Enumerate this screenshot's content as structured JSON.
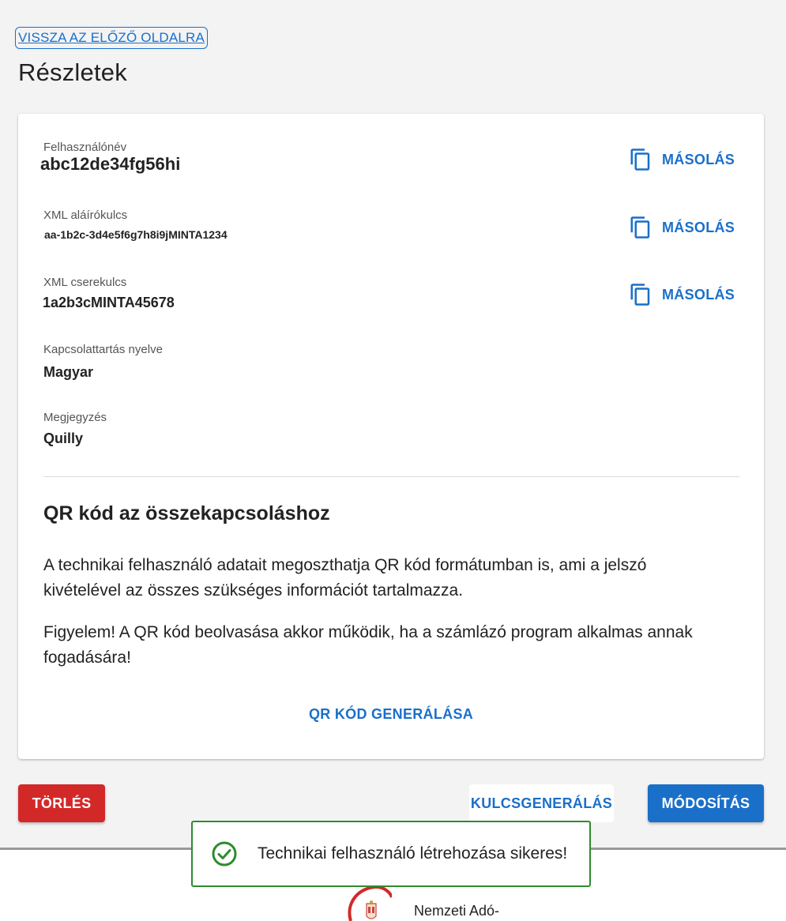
{
  "nav": {
    "back_label": "VISSZA AZ ELŐZŐ OLDALRA"
  },
  "page": {
    "title": "Részletek"
  },
  "details": {
    "username": {
      "label": "Felhasználónév",
      "value": "abc12de34fg56hi",
      "copy_label": "MÁSOLÁS"
    },
    "xml_signing_key": {
      "label": "XML aláírókulcs",
      "value": "aa-1b2c-3d4e5f6g7h8i9jMINTA1234",
      "copy_label": "MÁSOLÁS"
    },
    "xml_exchange_key": {
      "label": "XML cserekulcs",
      "value": "1a2b3cMINTA45678",
      "copy_label": "MÁSOLÁS"
    },
    "language": {
      "label": "Kapcsolattartás nyelve",
      "value": "Magyar"
    },
    "note": {
      "label": "Megjegyzés",
      "value": "Quilly"
    }
  },
  "qr": {
    "title": "QR kód az összekapcsoláshoz",
    "paragraph1": "A technikai felhasználó adatait megoszthatja QR kód formátumban is, ami a jelszó kivételével az összes szükséges információt tartalmazza.",
    "paragraph2": "Figyelem! A QR kód beolvasása akkor működik, ha a számlázó program alkalmas annak fogadására!",
    "generate_label": "QR KÓD GENERÁLÁSA"
  },
  "actions": {
    "delete_label": "TÖRLÉS",
    "keygen_label": "KULCSGENERÁLÁS",
    "modify_label": "MÓDOSÍTÁS"
  },
  "toast": {
    "message": "Technikai felhasználó létrehozása sikeres!",
    "icon": "check-circle-icon",
    "color": "#2e8b2e"
  },
  "footer": {
    "org_name": "Nemzeti Adó-"
  },
  "colors": {
    "primary": "#1a6fc9",
    "danger": "#d32828",
    "success": "#2e8b2e"
  }
}
